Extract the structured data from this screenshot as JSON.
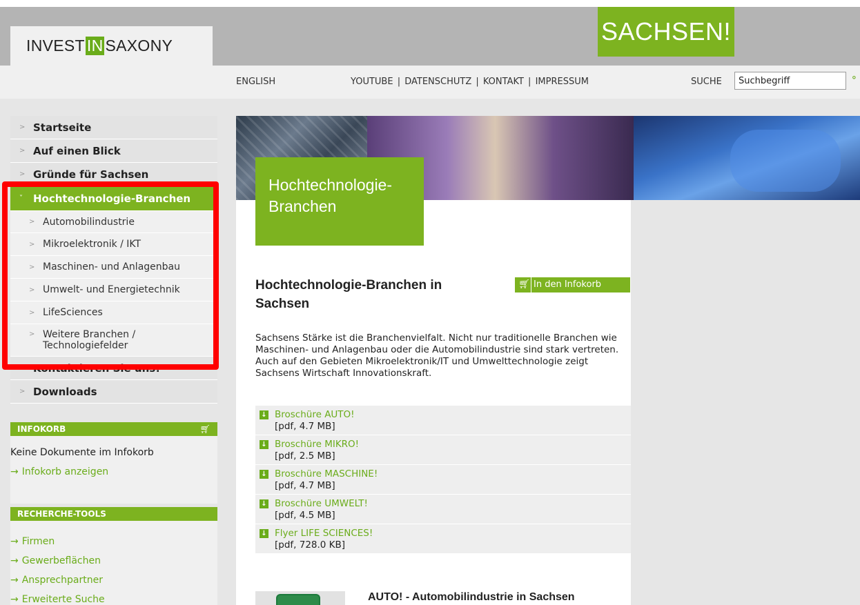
{
  "header": {
    "logo_pre": "INVEST",
    "logo_in": "IN",
    "logo_post": "SAXONY",
    "sachsen_logo": "SACHSEN!",
    "nav_english": "ENGLISH",
    "nav_links": [
      "YOUTUBE",
      "DATENSCHUTZ",
      "KONTAKT",
      "IMPRESSUM"
    ],
    "nav_links_text": "YOUTUBE | DATENSCHUTZ | KONTAKT | IMPRESSUM",
    "search_label": "SUCHE",
    "search_value": "Suchbegriff",
    "search_icon": "search-go-icon"
  },
  "sidebar": {
    "items": [
      {
        "label": "Startseite"
      },
      {
        "label": "Auf einen Blick"
      },
      {
        "label": "Gründe für Sachsen"
      },
      {
        "label": "Hochtechnologie-Branchen",
        "active": true
      },
      {
        "label": "Kontaktieren Sie uns!"
      },
      {
        "label": "Downloads"
      }
    ],
    "subitems": [
      {
        "label": "Automobilindustrie"
      },
      {
        "label": "Mikroelektronik / IKT"
      },
      {
        "label": "Maschinen- und Anlagenbau"
      },
      {
        "label": "Umwelt- und Energietechnik"
      },
      {
        "label": "LifeSciences"
      },
      {
        "label": "Weitere Branchen / Technologiefelder"
      }
    ],
    "infokorb": {
      "title": "INFOKORB",
      "empty_text": "Keine Dokumente im Infokorb",
      "show_link": "Infokorb anzeigen"
    },
    "tools": {
      "title": "RECHERCHE-TOOLS",
      "links": [
        "Firmen",
        "Gewerbeflächen",
        "Ansprechpartner",
        "Erweiterte Suche"
      ]
    }
  },
  "main": {
    "banner_title": "Hochtechnologie-Branchen",
    "banner_title_l1": "Hochtechnologie-",
    "banner_title_l2": "Branchen",
    "heading": "Hochtechnologie-Branchen in Sachsen",
    "infokorb_button": "In den Infokorb",
    "intro": "Sachsens Stärke ist die Branchenvielfalt. Nicht nur traditionelle Branchen wie Maschinen- und Anlagenbau oder die Automobilindustrie sind stark vertreten. Auch auf den Gebieten Mikroelektronik/IT und Umwelttechnologie zeigt Sachsens Wirtschaft Innovationskraft.",
    "downloads": [
      {
        "name": "Broschüre AUTO!",
        "meta": "[pdf, 4.7 MB]"
      },
      {
        "name": "Broschüre MIKRO!",
        "meta": "[pdf, 2.5 MB]"
      },
      {
        "name": "Broschüre MASCHINE!",
        "meta": "[pdf, 4.7 MB]"
      },
      {
        "name": "Broschüre UMWELT!",
        "meta": "[pdf, 4.5 MB]"
      },
      {
        "name": "Flyer LIFE SCIENCES!",
        "meta": "[pdf, 728.0 KB]"
      }
    ],
    "section_heading": "AUTO! - Automobilindustrie in Sachsen"
  },
  "colors": {
    "brand_green": "#7db320",
    "link_green": "#6aac1a",
    "highlight_red": "#ff0000"
  }
}
